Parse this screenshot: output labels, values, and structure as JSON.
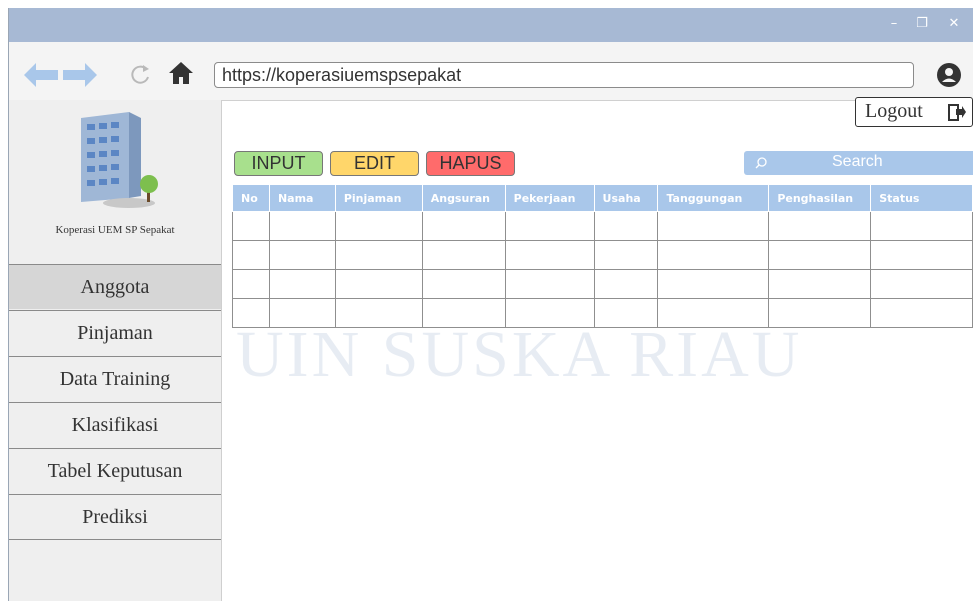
{
  "browser": {
    "url": "https://koperasiuemspsepakat",
    "window_controls": {
      "minimize": "–",
      "restore": "❐",
      "close": "✕"
    }
  },
  "sidebar": {
    "brand_label": "Koperasi UEM SP Sepakat",
    "items": [
      {
        "label": "Anggota",
        "active": true
      },
      {
        "label": "Pinjaman",
        "active": false
      },
      {
        "label": "Data Training",
        "active": false
      },
      {
        "label": "Klasifikasi",
        "active": false
      },
      {
        "label": "Tabel Keputusan",
        "active": false
      },
      {
        "label": "Prediksi",
        "active": false
      }
    ]
  },
  "header": {
    "logout_label": "Logout"
  },
  "actions": {
    "input_label": "INPUT",
    "edit_label": "EDIT",
    "hapus_label": "HAPUS"
  },
  "search": {
    "placeholder": "Search"
  },
  "table": {
    "columns": [
      "No",
      "Nama",
      "Pinjaman",
      "Angsuran",
      "Pekerjaan",
      "Usaha",
      "Tanggungan",
      "Penghasilan",
      "Status"
    ],
    "rows": [
      [
        "",
        "",
        "",
        "",
        "",
        "",
        "",
        "",
        ""
      ],
      [
        "",
        "",
        "",
        "",
        "",
        "",
        "",
        "",
        ""
      ],
      [
        "",
        "",
        "",
        "",
        "",
        "",
        "",
        "",
        ""
      ],
      [
        "",
        "",
        "",
        "",
        "",
        "",
        "",
        "",
        ""
      ]
    ]
  },
  "watermark": {
    "text": "UIN SUSKA RIAU"
  },
  "colors": {
    "titlebar": "#a7b9d4",
    "accent_blue": "#a9c7ea",
    "input_btn": "#a8e08d",
    "edit_btn": "#ffd66a",
    "hapus_btn": "#ff6b6b"
  },
  "icons": {
    "back": "back-arrow-icon",
    "forward": "forward-arrow-icon",
    "reload": "reload-icon",
    "home": "home-icon",
    "account": "account-icon",
    "building": "building-icon",
    "logout": "logout-icon",
    "search": "search-icon"
  }
}
